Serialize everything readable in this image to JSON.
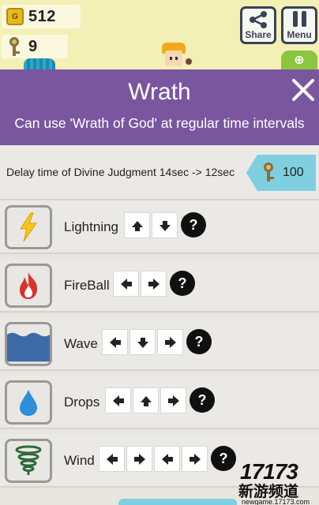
{
  "hud": {
    "coin_badge": "G",
    "coins": "512",
    "keys": "9"
  },
  "toolbar": {
    "share_label": "Share",
    "menu_label": "Menu"
  },
  "dialog": {
    "title": "Wrath",
    "subtitle": "Can use 'Wrath of God' at regular time intervals",
    "close_icon": "close-icon"
  },
  "upgrade": {
    "description": "Delay time of Divine Judgment 14sec -> 12sec",
    "cost": "100",
    "currency_icon": "key-icon"
  },
  "skills": [
    {
      "name": "Lightning",
      "icon": "lightning-icon",
      "combo": [
        "up",
        "down"
      ]
    },
    {
      "name": "FireBall",
      "icon": "fireball-icon",
      "combo": [
        "left",
        "right"
      ]
    },
    {
      "name": "Wave",
      "icon": "wave-icon",
      "combo": [
        "left",
        "down",
        "right"
      ]
    },
    {
      "name": "Drops",
      "icon": "drop-icon",
      "combo": [
        "left",
        "up",
        "right"
      ]
    },
    {
      "name": "Wind",
      "icon": "wind-icon",
      "combo": [
        "left",
        "right",
        "left",
        "right"
      ]
    }
  ],
  "help_glyph": "?",
  "colors": {
    "header": "#7a569f",
    "accent": "#7fcfe0",
    "bar": "#f3f0b6"
  },
  "watermark": {
    "logo": "17173",
    "name": "新游频道",
    "url": "newgame.17173.com"
  }
}
